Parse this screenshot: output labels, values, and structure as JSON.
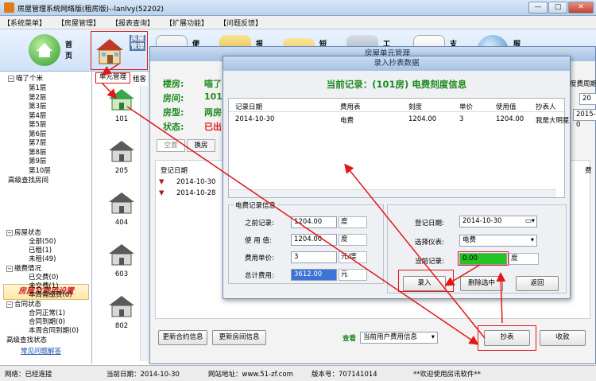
{
  "window": {
    "title": "房屋管理系统网络版(租房版)--lanlvy(52202)",
    "min": "—",
    "max": "□",
    "close": "✕"
  },
  "menu": [
    "【系统菜单】",
    "【房屋管理】",
    "【报表查询】",
    "【扩展功能】",
    "【问题反馈】"
  ],
  "toolbar": [
    {
      "label": "首页",
      "icon": "home-icon"
    },
    {
      "label": "房屋管理",
      "icon": "house-icon"
    },
    {
      "label": "便",
      "icon": "calendar-icon"
    },
    {
      "label": "报",
      "icon": "report-icon"
    },
    {
      "label": "短",
      "icon": "mail-icon"
    },
    {
      "label": "工",
      "icon": "tools-icon"
    },
    {
      "label": "支",
      "icon": "contacts-icon"
    },
    {
      "label": "服",
      "icon": "globe-icon"
    }
  ],
  "tree1": {
    "root": "喵了个米",
    "floors": [
      "第1层",
      "第2层",
      "第3层",
      "第4层",
      "第5层",
      "第6层",
      "第7层",
      "第8层",
      "第9层",
      "第10层"
    ],
    "advanced": "高级查找房间"
  },
  "fee_banner": "房屋及费用设置",
  "tree2": {
    "house_status": "房屋状态",
    "house_items": [
      "全部(50)",
      "已租(1)",
      "未租(49)"
    ],
    "pay_status": "缴费情况",
    "pay_items": [
      "已交费(0)",
      "未交费(1)",
      "本周需缴费(0)"
    ],
    "contract_status": "合同状态",
    "contract_items": [
      "合同正常(1)",
      "合同到期(0)",
      "本周合同到期(0)"
    ],
    "advanced_status": "高级查找状态",
    "faq_link": "常见问题解答"
  },
  "rooms": [
    "101",
    "205",
    "404",
    "603",
    "802"
  ],
  "unit_panel": {
    "title": "房屋单元管理",
    "tab_active": "单元管理",
    "tab_other": "租客",
    "building_label": "楼房:",
    "building_value": "喵了",
    "room_label": "房间:",
    "room_value": "101",
    "type_label": "房型:",
    "type_value": "两房",
    "status_label": "状态:",
    "status_value": "已出",
    "subtab_empty": "空置",
    "subtab_change": "换房",
    "reg_date_label": "登记日期",
    "reg_dates": [
      "2014-10-30",
      "2014-10-28"
    ],
    "right_col1": "度费周期",
    "right_col2": "费",
    "right_date1": "20",
    "right_date2": "2015-0",
    "update_contract": "更新合约信息",
    "update_room": "更新房间信息",
    "query_label": "查看",
    "query_select": "当前用户费用信息",
    "meter_button": "抄表",
    "collect_button": "收款"
  },
  "dialog": {
    "title": "录入抄表数据",
    "heading": "当前记录：(101房) 电费刻度信息",
    "columns": [
      "记录日期",
      "费用表",
      "刻度",
      "单价",
      "使用值",
      "抄表人"
    ],
    "rows": [
      [
        "2014-10-30",
        "电费",
        "1204.00",
        "3",
        "1204.00",
        "我是大明星"
      ]
    ],
    "group_title": "电费记录信息",
    "prev_label": "之前记录:",
    "prev_value": "1204.00",
    "prev_unit": "度",
    "usage_label": "使 用 值:",
    "usage_value": "1204.00",
    "usage_unit": "度",
    "price_label": "费用单价:",
    "price_value": "3",
    "price_unit": "元/度",
    "total_label": "总计费用:",
    "total_value": "3612.00",
    "total_unit": "元",
    "date_label": "登记日期:",
    "date_value": "2014-10-30",
    "meter_label": "选择仪表:",
    "meter_value": "电费",
    "current_label": "当前记录:",
    "current_value": "0.00",
    "current_unit": "度",
    "enter_button": "录入",
    "delete_button": "删除选中",
    "back_button": "返回"
  },
  "status": {
    "network": "网络：已经连接",
    "date": "当前日期：2014-10-30",
    "site": "网站地址：www.51-zf.com",
    "version": "版本号：707141014",
    "welcome": "**欢迎使用房讯软件**"
  },
  "colors": {
    "accent_green": "#1e8a1e",
    "alert_red": "#e01818",
    "current_fill": "#22c322"
  }
}
